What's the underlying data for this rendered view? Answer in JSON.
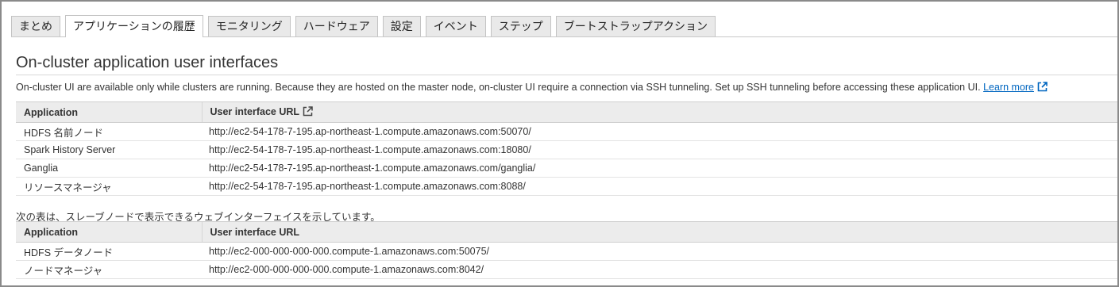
{
  "tabs": [
    {
      "label": "まとめ",
      "active": false
    },
    {
      "label": "アプリケーションの履歴",
      "active": true
    },
    {
      "label": "モニタリング",
      "active": false
    },
    {
      "label": "ハードウェア",
      "active": false
    },
    {
      "label": "設定",
      "active": false
    },
    {
      "label": "イベント",
      "active": false
    },
    {
      "label": "ステップ",
      "active": false
    },
    {
      "label": "ブートストラップアクション",
      "active": false
    }
  ],
  "section": {
    "title": "On-cluster application user interfaces",
    "description": "On-cluster UI are available only while clusters are running. Because they are hosted on the master node, on-cluster UI require a connection via SSH tunneling. Set up SSH tunneling before accessing these application UI.",
    "learn_more": "Learn more"
  },
  "master_table": {
    "headers": {
      "application": "Application",
      "url": "User interface URL"
    },
    "rows": [
      {
        "application": "HDFS 名前ノード",
        "url": "http://ec2-54-178-7-195.ap-northeast-1.compute.amazonaws.com:50070/"
      },
      {
        "application": "Spark History Server",
        "url": "http://ec2-54-178-7-195.ap-northeast-1.compute.amazonaws.com:18080/"
      },
      {
        "application": "Ganglia",
        "url": "http://ec2-54-178-7-195.ap-northeast-1.compute.amazonaws.com/ganglia/"
      },
      {
        "application": "リソースマネージャ",
        "url": "http://ec2-54-178-7-195.ap-northeast-1.compute.amazonaws.com:8088/"
      }
    ]
  },
  "slave_note": "次の表は、スレーブノードで表示できるウェブインターフェイスを示しています。",
  "slave_table": {
    "headers": {
      "application": "Application",
      "url": "User interface URL"
    },
    "rows": [
      {
        "application": "HDFS データノード",
        "url": "http://ec2-000-000-000-000.compute-1.amazonaws.com:50075/"
      },
      {
        "application": "ノードマネージャ",
        "url": "http://ec2-000-000-000-000.compute-1.amazonaws.com:8042/"
      }
    ]
  },
  "colors": {
    "link": "#0066c0",
    "tab_bg": "#e9e9e9",
    "header_bg": "#ececec"
  },
  "icons": {
    "external_link": "external-link-icon"
  }
}
